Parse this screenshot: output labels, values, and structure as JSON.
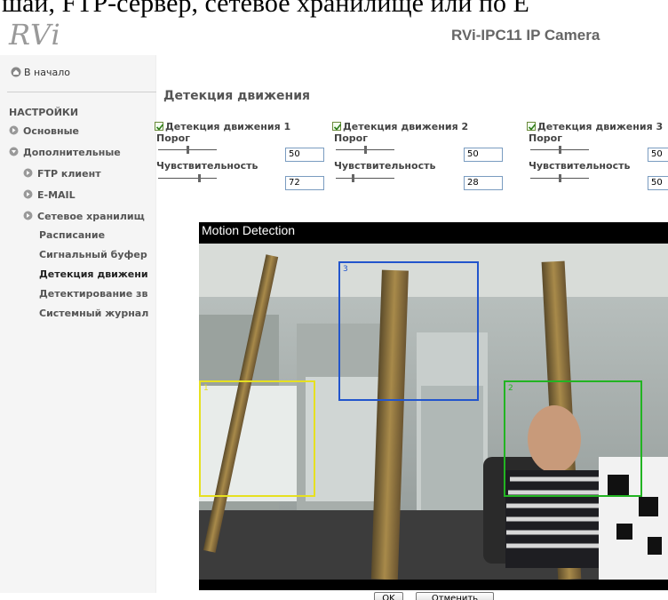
{
  "caption": "шаи, FTP-сервер, сетевое хранилище или по Е",
  "header": {
    "logo": "RVi",
    "product": "RVi-IPC11 IP Camera"
  },
  "sidebar": {
    "home": "В начало",
    "section": "НАСТРОЙКИ",
    "items": [
      {
        "label": "Основные"
      },
      {
        "label": "Дополнительные"
      },
      {
        "label": "FTP клиент"
      },
      {
        "label": "E-MAIL"
      },
      {
        "label": "Сетевое хранилищ"
      },
      {
        "label": "Расписание"
      },
      {
        "label": "Сигнальный буфер"
      },
      {
        "label": "Детекция движени"
      },
      {
        "label": "Детектирование зв"
      },
      {
        "label": "Системный журнал"
      }
    ]
  },
  "main": {
    "title": "Детекция движения",
    "threshold_label": "Порог",
    "sensitivity_label": "Чувствительность",
    "zones": [
      {
        "title": "Детекция движения 1",
        "threshold": "50",
        "sensitivity": "72",
        "threshold_level": 50,
        "sensitivity_level": 72
      },
      {
        "title": "Детекция движения 2",
        "threshold": "50",
        "sensitivity": "28",
        "threshold_level": 50,
        "sensitivity_level": 28
      },
      {
        "title": "Детекция движения 3",
        "threshold": "50",
        "sensitivity": "50",
        "threshold_level": 50,
        "sensitivity_level": 50
      }
    ]
  },
  "panel": {
    "title": "Motion Detection",
    "zone_labels": [
      "1",
      "2",
      "3"
    ],
    "zone_colors": {
      "1": "#e6e020",
      "2": "#22b422",
      "3": "#2255cc"
    }
  },
  "buttons": {
    "ok": "OK",
    "cancel": "Отменить"
  }
}
